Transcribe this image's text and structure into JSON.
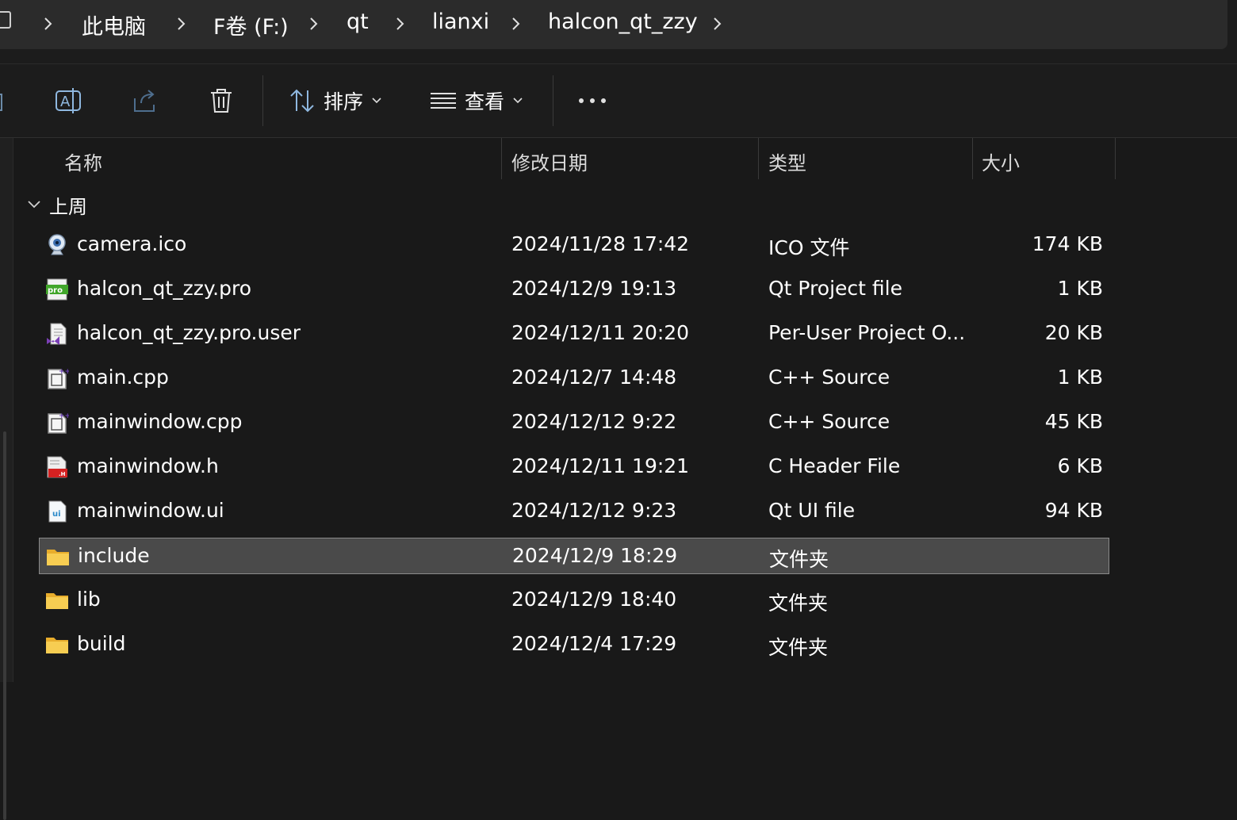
{
  "breadcrumb": {
    "items": [
      "此电脑",
      "F卷 (F:)",
      "qt",
      "lianxi",
      "halcon_qt_zzy"
    ]
  },
  "toolbar": {
    "sort_label": "排序",
    "view_label": "查看"
  },
  "columns": {
    "name": "名称",
    "date": "修改日期",
    "type": "类型",
    "size": "大小"
  },
  "group": {
    "label": "上周"
  },
  "files": [
    {
      "name": "camera.ico",
      "date": "2024/11/28 17:42",
      "type": "ICO 文件",
      "size": "174 KB",
      "icon": "camera-icon"
    },
    {
      "name": "halcon_qt_zzy.pro",
      "date": "2024/12/9 19:13",
      "type": "Qt Project file",
      "size": "1 KB",
      "icon": "pro-file-icon"
    },
    {
      "name": "halcon_qt_zzy.pro.user",
      "date": "2024/12/11 20:20",
      "type": "Per-User Project O...",
      "size": "20 KB",
      "icon": "vs-file-icon"
    },
    {
      "name": "main.cpp",
      "date": "2024/12/7 14:48",
      "type": "C++ Source",
      "size": "1 KB",
      "icon": "cpp-file-icon"
    },
    {
      "name": "mainwindow.cpp",
      "date": "2024/12/12 9:22",
      "type": "C++ Source",
      "size": "45 KB",
      "icon": "cpp-file-icon"
    },
    {
      "name": "mainwindow.h",
      "date": "2024/12/11 19:21",
      "type": "C Header File",
      "size": "6 KB",
      "icon": "header-file-icon"
    },
    {
      "name": "mainwindow.ui",
      "date": "2024/12/12 9:23",
      "type": "Qt UI file",
      "size": "94 KB",
      "icon": "ui-file-icon"
    },
    {
      "name": "include",
      "date": "2024/12/9 18:29",
      "type": "文件夹",
      "size": "",
      "icon": "folder-icon",
      "selected": true
    },
    {
      "name": "lib",
      "date": "2024/12/9 18:40",
      "type": "文件夹",
      "size": "",
      "icon": "folder-icon"
    },
    {
      "name": "build",
      "date": "2024/12/4 17:29",
      "type": "文件夹",
      "size": "",
      "icon": "folder-icon"
    }
  ],
  "colors": {
    "background": "#191919",
    "selected_row": "#4a4a4a",
    "folder": "#f5c84c"
  }
}
